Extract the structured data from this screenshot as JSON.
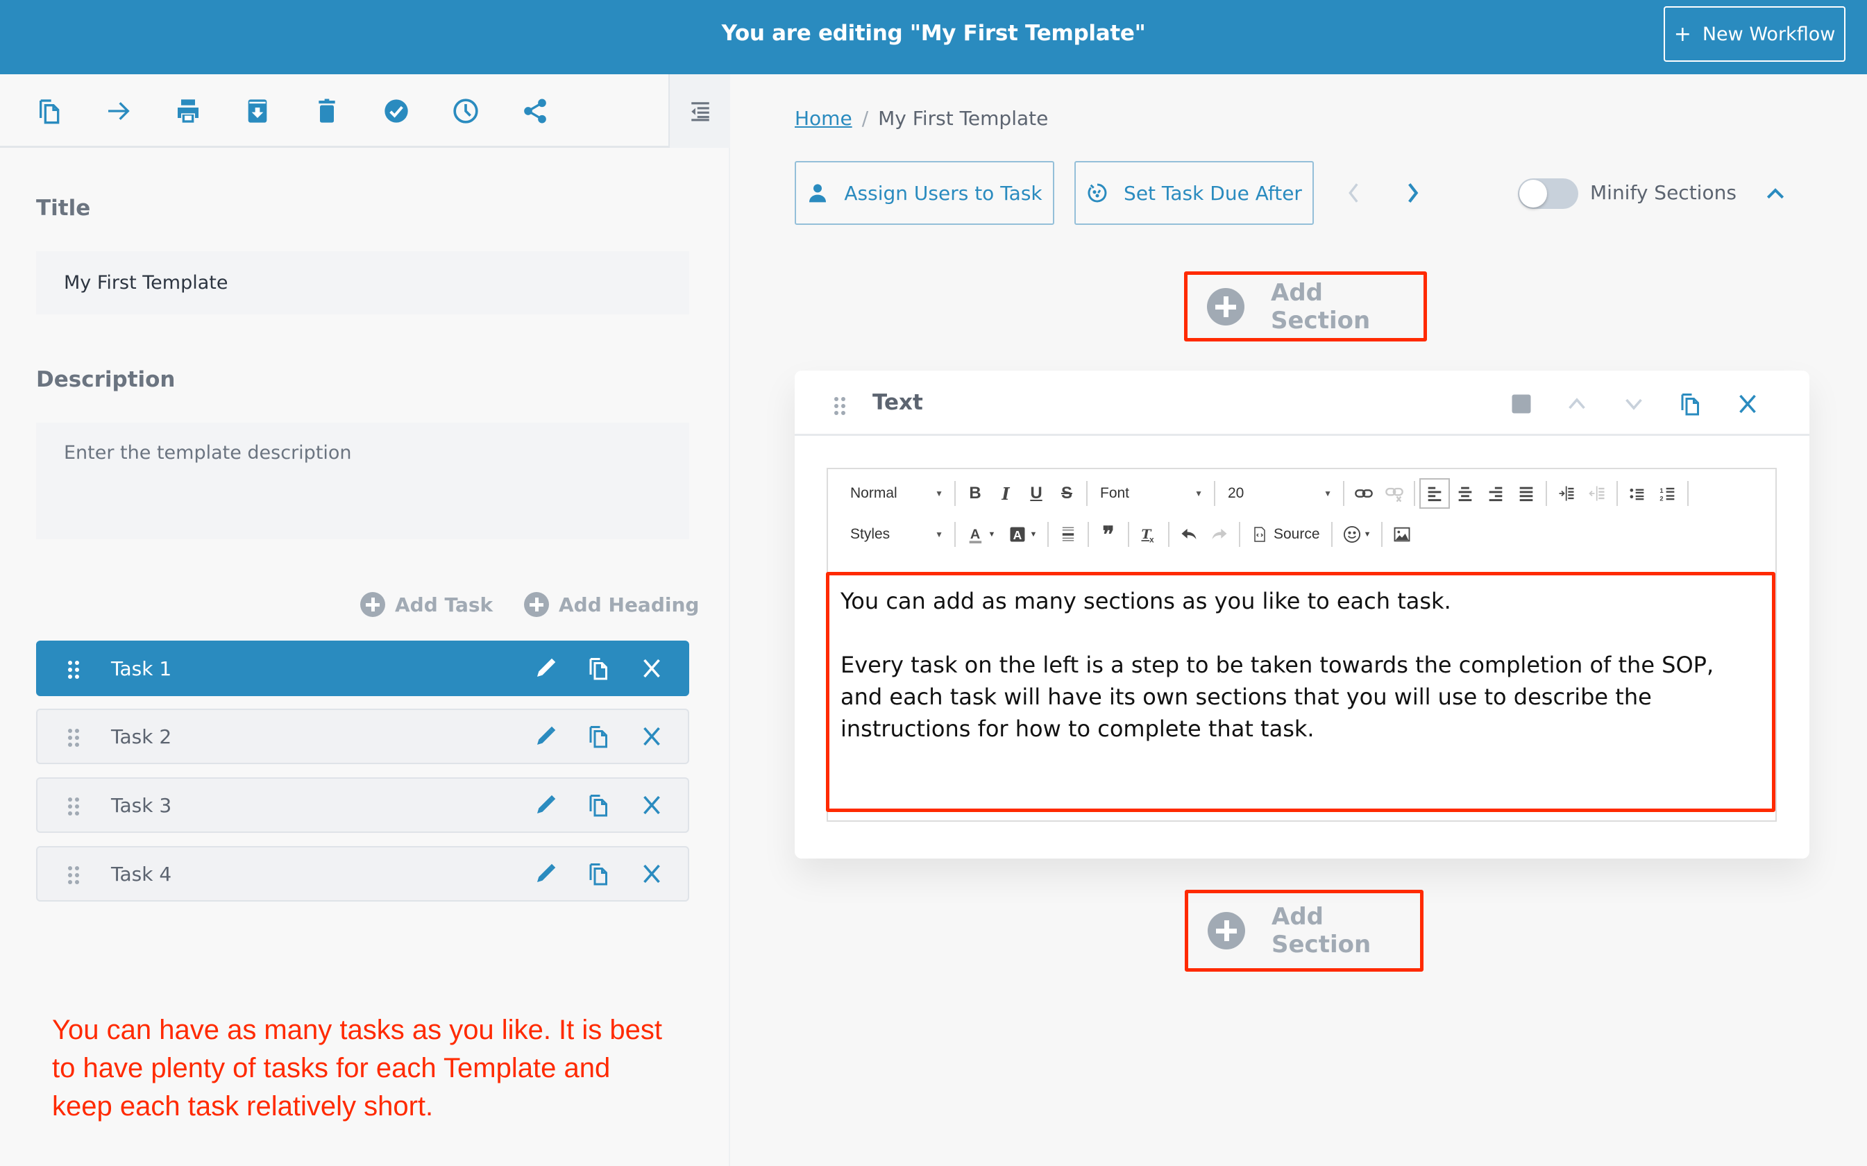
{
  "header": {
    "title": "You are editing \"My First Template\"",
    "new_workflow_plus": "+",
    "new_workflow_label": "New Workflow"
  },
  "left_toolbar": {
    "icons": [
      "duplicate-icon",
      "arrow-right-icon",
      "print-icon",
      "archive-icon",
      "trash-icon",
      "check-circle-icon",
      "clock-icon",
      "share-icon"
    ],
    "collapse_icon": "indent-icon"
  },
  "template": {
    "title_label": "Title",
    "title_value": "My First Template",
    "description_label": "Description",
    "description_placeholder": "Enter the template description"
  },
  "task_actions": {
    "add_task": "Add Task",
    "add_heading": "Add Heading"
  },
  "tasks": [
    {
      "name": "Task 1",
      "active": true
    },
    {
      "name": "Task 2",
      "active": false
    },
    {
      "name": "Task 3",
      "active": false
    },
    {
      "name": "Task 4",
      "active": false
    }
  ],
  "annotation_note": "You can have as many tasks as you like. It is best to have plenty of tasks for each Template and keep each task relatively short.",
  "breadcrumb": {
    "home": "Home",
    "separator": "/",
    "current": "My First Template"
  },
  "action_bar": {
    "assign_users": "Assign Users to Task",
    "set_due": "Set Task Due After",
    "minify_label": "Minify Sections",
    "minify_on": false
  },
  "add_section_label": "Add Section",
  "section": {
    "title": "Text",
    "editor": {
      "format_select": "Normal",
      "styles_select": "Styles",
      "font_select": "Font",
      "size_select": "20",
      "bold": "B",
      "italic": "I",
      "underline": "U",
      "strike": "S",
      "source_label": "Source",
      "active_alignment": "left",
      "paragraphs": [
        "You can add as many sections as you like to each task.",
        "Every task on the left is a step to be taken towards the completion of the SOP, and each task will have its own sections that you will use to describe the instructions for how to complete that task."
      ]
    }
  },
  "colors": {
    "brand": "#2a8bbf",
    "annotation_red": "#ff2a00",
    "muted": "#a1aab4"
  }
}
